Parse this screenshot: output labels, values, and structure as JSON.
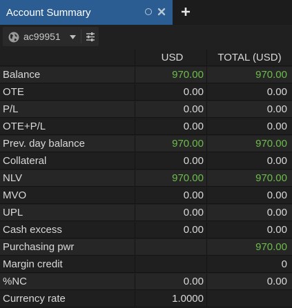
{
  "tab": {
    "title": "Account Summary"
  },
  "toolbar": {
    "account": "ac99951"
  },
  "columns": {
    "label": "",
    "usd": "USD",
    "total": "TOTAL (USD)"
  },
  "rows": [
    {
      "label": "Balance",
      "usd": "970.00",
      "total": "970.00",
      "positive": true
    },
    {
      "label": "OTE",
      "usd": "0.00",
      "total": "0.00",
      "positive": false
    },
    {
      "label": "P/L",
      "usd": "0.00",
      "total": "0.00",
      "positive": false
    },
    {
      "label": "OTE+P/L",
      "usd": "0.00",
      "total": "0.00",
      "positive": false
    },
    {
      "label": "Prev. day balance",
      "usd": "970.00",
      "total": "970.00",
      "positive": true
    },
    {
      "label": "Collateral",
      "usd": "0.00",
      "total": "0.00",
      "positive": false
    },
    {
      "label": "NLV",
      "usd": "970.00",
      "total": "970.00",
      "positive": true
    },
    {
      "label": "MVO",
      "usd": "0.00",
      "total": "0.00",
      "positive": false
    },
    {
      "label": "UPL",
      "usd": "0.00",
      "total": "0.00",
      "positive": false
    },
    {
      "label": "Cash excess",
      "usd": "0.00",
      "total": "0.00",
      "positive": false
    },
    {
      "label": "Purchasing pwr",
      "usd": "",
      "total": "970.00",
      "positive": true
    },
    {
      "label": "Margin credit",
      "usd": "",
      "total": "0",
      "positive": false
    },
    {
      "label": "%NC",
      "usd": "0.00",
      "total": "0.00",
      "positive": false
    },
    {
      "label": "Currency rate",
      "usd": "1.0000",
      "total": "",
      "positive": false
    }
  ],
  "colors": {
    "tab_active": "#2c5d92",
    "positive": "#6dbd4a",
    "background": "#1e1e1e"
  },
  "icons": [
    "circle-icon",
    "close-icon",
    "plus-icon",
    "globe-icon",
    "chevron-down-icon",
    "sliders-icon"
  ]
}
